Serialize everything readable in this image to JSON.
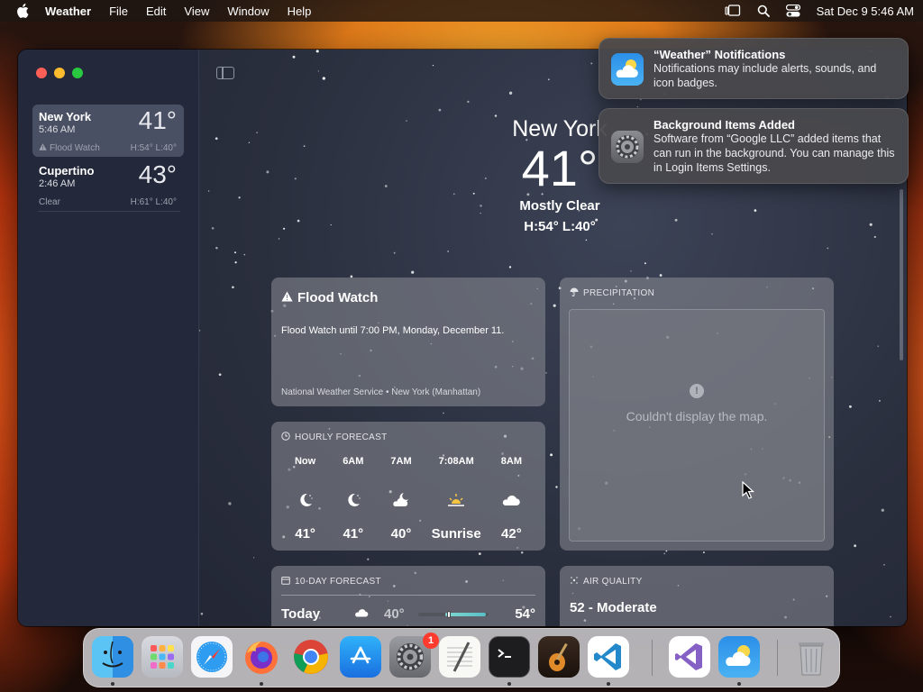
{
  "menubar": {
    "app_name": "Weather",
    "items": [
      "File",
      "Edit",
      "View",
      "Window",
      "Help"
    ],
    "clock": "Sat Dec 9  5:46 AM"
  },
  "sidebar": {
    "cities": [
      {
        "name": "New York",
        "time": "5:46 AM",
        "temp": "41°",
        "condition": "Flood Watch",
        "hilo": "H:54°  L:40°",
        "selected": true
      },
      {
        "name": "Cupertino",
        "time": "2:46 AM",
        "temp": "43°",
        "condition": "Clear",
        "hilo": "H:61°  L:40°",
        "selected": false
      }
    ]
  },
  "hero": {
    "city": "New York",
    "temp": "41°",
    "condition": "Mostly Clear",
    "hilo": "H:54°  L:40°"
  },
  "flood": {
    "title": "Flood Watch",
    "body": "Flood Watch until 7:00 PM, Monday, December 11.",
    "source": "National Weather Service • New York (Manhattan)"
  },
  "hourly": {
    "header": "HOURLY FORECAST",
    "items": [
      {
        "time": "Now",
        "icon": "moon-icon",
        "value": "41°"
      },
      {
        "time": "6AM",
        "icon": "moon-icon",
        "value": "41°"
      },
      {
        "time": "7AM",
        "icon": "cloud-moon-icon",
        "value": "40°"
      },
      {
        "time": "7:08AM",
        "icon": "sunrise-icon",
        "value": "Sunrise"
      },
      {
        "time": "8AM",
        "icon": "cloud-icon",
        "value": "42°"
      }
    ]
  },
  "precipitation": {
    "header": "PRECIPITATION",
    "message": "Couldn't display the map."
  },
  "tenday": {
    "header": "10-DAY FORECAST",
    "rows": [
      {
        "day": "Today",
        "icon": "cloud-icon",
        "low": "40°",
        "high": "54°",
        "current_position": 0.04
      }
    ]
  },
  "air_quality": {
    "header": "AIR QUALITY",
    "value": "52 - Moderate"
  },
  "notifications": [
    {
      "title": "“Weather” Notifications",
      "body": "Notifications may include alerts, sounds, and icon badges.",
      "icon": "weather-app-icon"
    },
    {
      "title": "Background Items Added",
      "body": "Software from “Google LLC” added items that can run in the background. You can manage this in Login Items Settings.",
      "icon": "settings-gear-icon"
    }
  ],
  "dock": {
    "apps": [
      "Finder",
      "Launchpad",
      "Safari",
      "Firefox",
      "Chrome",
      "App Store",
      "System Settings",
      "TextEdit",
      "Terminal",
      "GarageBand",
      "Visual Studio Code",
      "Visual Studio",
      "Weather",
      "Trash"
    ],
    "settings_badge": "1"
  },
  "colors": {
    "window_bg": "#1f2433",
    "sidebar_bg": "#23283a",
    "card_bg": "#8c8e96",
    "notification_bg": "#48484c",
    "dock_bg": "#d7d7dc",
    "badge": "#ff3b30"
  }
}
